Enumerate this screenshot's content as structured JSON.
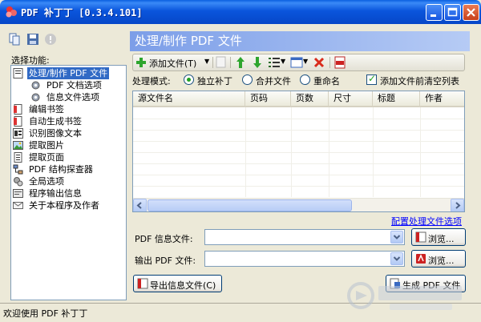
{
  "window": {
    "title": "PDF 补丁丁 [0.3.4.101]"
  },
  "left_panel": {
    "select_label": "选择功能:",
    "items": [
      {
        "label": "处理/制作 PDF 文件",
        "icon": "document-icon",
        "selected": true
      },
      {
        "label": "PDF 文档选项",
        "icon": "gear-icon",
        "sub": true
      },
      {
        "label": "信息文件选项",
        "icon": "gear-icon",
        "sub": true
      },
      {
        "label": "编辑书签",
        "icon": "bookmark-icon"
      },
      {
        "label": "自动生成书签",
        "icon": "bookmark-icon"
      },
      {
        "label": "识别图像文本",
        "icon": "ocr-icon"
      },
      {
        "label": "提取图片",
        "icon": "image-icon"
      },
      {
        "label": "提取页面",
        "icon": "page-icon"
      },
      {
        "label": "PDF 结构探查器",
        "icon": "structure-icon"
      },
      {
        "label": "全局选项",
        "icon": "options-icon"
      },
      {
        "label": "程序输出信息",
        "icon": "output-icon"
      },
      {
        "label": "关于本程序及作者",
        "icon": "mail-icon"
      }
    ]
  },
  "main": {
    "header": "处理/制作 PDF 文件",
    "toolbar": {
      "add_file_label": "添加文件(T)"
    },
    "mode": {
      "label": "处理模式:",
      "options": [
        "独立补丁",
        "合并文件",
        "重命名"
      ],
      "selected": "独立补丁",
      "clear_list_label": "添加文件前清空列表",
      "clear_list_checked": true
    },
    "table": {
      "columns": [
        "源文件名",
        "页码",
        "页数",
        "尺寸",
        "标题",
        "作者"
      ]
    },
    "config_link": "配置处理文件选项",
    "pdf_info_label": "PDF 信息文件:",
    "pdf_info_value": "",
    "browse_label": "浏览...",
    "output_label": "输出 PDF 文件:",
    "output_value": "",
    "export_info_label": "导出信息文件(C)",
    "generate_label": "生成 PDF 文件"
  },
  "status": {
    "text": "欢迎使用 PDF 补丁丁"
  },
  "colors": {
    "titlebar": "#0a55dc",
    "header_start": "#7c9ee8",
    "link": "#0000ff",
    "selection": "#316ac5"
  }
}
